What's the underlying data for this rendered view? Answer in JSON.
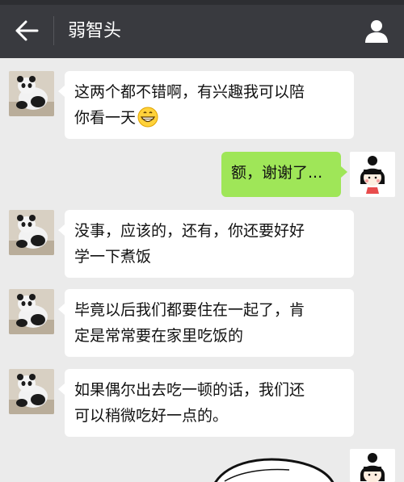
{
  "header": {
    "title": "弱智头",
    "back_icon": "arrow-left-icon",
    "profile_icon": "user-icon"
  },
  "messages": [
    {
      "side": "left",
      "line1": "这两个都不错啊，有兴趣我可以陪",
      "line2": "你看一天",
      "emoji": "grinning-face-icon"
    },
    {
      "side": "right",
      "line1": "额，谢谢了..."
    },
    {
      "side": "left",
      "line1": "没事，应该的，还有，你还要好好",
      "line2": "学一下煮饭"
    },
    {
      "side": "left",
      "line1": "毕竟以后我们都要住在一起了，肯",
      "line2": "定是常常要在家里吃饭的"
    },
    {
      "side": "left",
      "line1": "如果偶尔出去吃一顿的话，我们还",
      "line2": "可以稍微吃好一点的。"
    }
  ],
  "colors": {
    "header_bg": "#393a3f",
    "chat_bg": "#ebebeb",
    "bubble_left": "#ffffff",
    "bubble_right": "#9fe658"
  }
}
